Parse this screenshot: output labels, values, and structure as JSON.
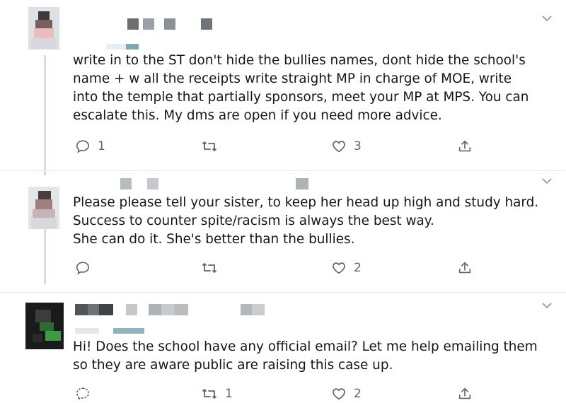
{
  "tweets": [
    {
      "text": "write in to the ST don't hide the bullies names, dont hide the school's\nname + w all the receipts write straight MP in charge of MOE, write\ninto the temple that partially sponsors, meet your MP at MPS. You can\nescalate this. My dms are open if you need more advice.",
      "replies": "1",
      "retweets": "",
      "likes": "3"
    },
    {
      "text": "Please please tell your sister, to keep her head up high and study hard.\nSuccess to counter spite/racism is always the best way.\nShe can do it. She's better than the bullies.",
      "replies": "",
      "retweets": "",
      "likes": "2"
    },
    {
      "text": "Hi! Does the school have any official email? Let me help emailing them\nso they are aware public are raising this case up.",
      "replies": "",
      "retweets": "1",
      "likes": "2"
    }
  ],
  "icons": {
    "reply": "reply-icon",
    "retweet": "retweet-icon",
    "like": "heart-icon",
    "share": "share-icon",
    "more": "chevron-down-icon"
  },
  "colors": {
    "text": "#14171a",
    "icon": "#5b6670",
    "thread_line": "#d5dbe0",
    "divider": "#e6ecf0"
  }
}
